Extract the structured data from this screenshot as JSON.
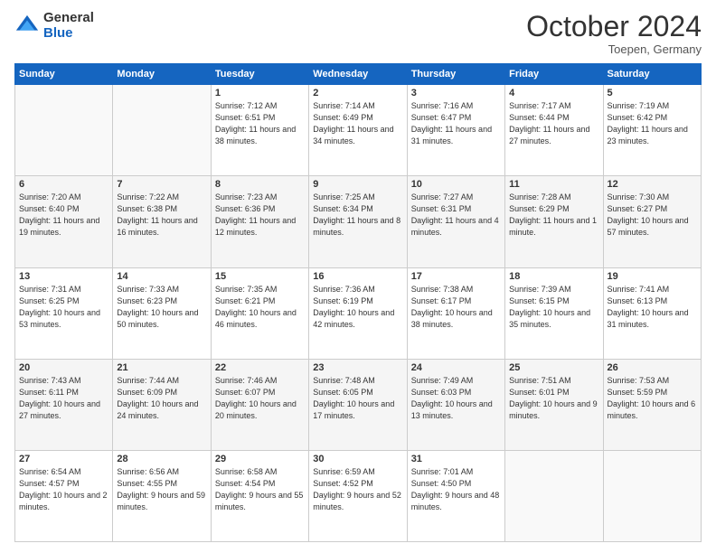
{
  "logo": {
    "general": "General",
    "blue": "Blue"
  },
  "header": {
    "month": "October 2024",
    "location": "Toepen, Germany"
  },
  "weekdays": [
    "Sunday",
    "Monday",
    "Tuesday",
    "Wednesday",
    "Thursday",
    "Friday",
    "Saturday"
  ],
  "weeks": [
    [
      {
        "day": "",
        "info": ""
      },
      {
        "day": "",
        "info": ""
      },
      {
        "day": "1",
        "info": "Sunrise: 7:12 AM\nSunset: 6:51 PM\nDaylight: 11 hours and 38 minutes."
      },
      {
        "day": "2",
        "info": "Sunrise: 7:14 AM\nSunset: 6:49 PM\nDaylight: 11 hours and 34 minutes."
      },
      {
        "day": "3",
        "info": "Sunrise: 7:16 AM\nSunset: 6:47 PM\nDaylight: 11 hours and 31 minutes."
      },
      {
        "day": "4",
        "info": "Sunrise: 7:17 AM\nSunset: 6:44 PM\nDaylight: 11 hours and 27 minutes."
      },
      {
        "day": "5",
        "info": "Sunrise: 7:19 AM\nSunset: 6:42 PM\nDaylight: 11 hours and 23 minutes."
      }
    ],
    [
      {
        "day": "6",
        "info": "Sunrise: 7:20 AM\nSunset: 6:40 PM\nDaylight: 11 hours and 19 minutes."
      },
      {
        "day": "7",
        "info": "Sunrise: 7:22 AM\nSunset: 6:38 PM\nDaylight: 11 hours and 16 minutes."
      },
      {
        "day": "8",
        "info": "Sunrise: 7:23 AM\nSunset: 6:36 PM\nDaylight: 11 hours and 12 minutes."
      },
      {
        "day": "9",
        "info": "Sunrise: 7:25 AM\nSunset: 6:34 PM\nDaylight: 11 hours and 8 minutes."
      },
      {
        "day": "10",
        "info": "Sunrise: 7:27 AM\nSunset: 6:31 PM\nDaylight: 11 hours and 4 minutes."
      },
      {
        "day": "11",
        "info": "Sunrise: 7:28 AM\nSunset: 6:29 PM\nDaylight: 11 hours and 1 minute."
      },
      {
        "day": "12",
        "info": "Sunrise: 7:30 AM\nSunset: 6:27 PM\nDaylight: 10 hours and 57 minutes."
      }
    ],
    [
      {
        "day": "13",
        "info": "Sunrise: 7:31 AM\nSunset: 6:25 PM\nDaylight: 10 hours and 53 minutes."
      },
      {
        "day": "14",
        "info": "Sunrise: 7:33 AM\nSunset: 6:23 PM\nDaylight: 10 hours and 50 minutes."
      },
      {
        "day": "15",
        "info": "Sunrise: 7:35 AM\nSunset: 6:21 PM\nDaylight: 10 hours and 46 minutes."
      },
      {
        "day": "16",
        "info": "Sunrise: 7:36 AM\nSunset: 6:19 PM\nDaylight: 10 hours and 42 minutes."
      },
      {
        "day": "17",
        "info": "Sunrise: 7:38 AM\nSunset: 6:17 PM\nDaylight: 10 hours and 38 minutes."
      },
      {
        "day": "18",
        "info": "Sunrise: 7:39 AM\nSunset: 6:15 PM\nDaylight: 10 hours and 35 minutes."
      },
      {
        "day": "19",
        "info": "Sunrise: 7:41 AM\nSunset: 6:13 PM\nDaylight: 10 hours and 31 minutes."
      }
    ],
    [
      {
        "day": "20",
        "info": "Sunrise: 7:43 AM\nSunset: 6:11 PM\nDaylight: 10 hours and 27 minutes."
      },
      {
        "day": "21",
        "info": "Sunrise: 7:44 AM\nSunset: 6:09 PM\nDaylight: 10 hours and 24 minutes."
      },
      {
        "day": "22",
        "info": "Sunrise: 7:46 AM\nSunset: 6:07 PM\nDaylight: 10 hours and 20 minutes."
      },
      {
        "day": "23",
        "info": "Sunrise: 7:48 AM\nSunset: 6:05 PM\nDaylight: 10 hours and 17 minutes."
      },
      {
        "day": "24",
        "info": "Sunrise: 7:49 AM\nSunset: 6:03 PM\nDaylight: 10 hours and 13 minutes."
      },
      {
        "day": "25",
        "info": "Sunrise: 7:51 AM\nSunset: 6:01 PM\nDaylight: 10 hours and 9 minutes."
      },
      {
        "day": "26",
        "info": "Sunrise: 7:53 AM\nSunset: 5:59 PM\nDaylight: 10 hours and 6 minutes."
      }
    ],
    [
      {
        "day": "27",
        "info": "Sunrise: 6:54 AM\nSunset: 4:57 PM\nDaylight: 10 hours and 2 minutes."
      },
      {
        "day": "28",
        "info": "Sunrise: 6:56 AM\nSunset: 4:55 PM\nDaylight: 9 hours and 59 minutes."
      },
      {
        "day": "29",
        "info": "Sunrise: 6:58 AM\nSunset: 4:54 PM\nDaylight: 9 hours and 55 minutes."
      },
      {
        "day": "30",
        "info": "Sunrise: 6:59 AM\nSunset: 4:52 PM\nDaylight: 9 hours and 52 minutes."
      },
      {
        "day": "31",
        "info": "Sunrise: 7:01 AM\nSunset: 4:50 PM\nDaylight: 9 hours and 48 minutes."
      },
      {
        "day": "",
        "info": ""
      },
      {
        "day": "",
        "info": ""
      }
    ]
  ]
}
